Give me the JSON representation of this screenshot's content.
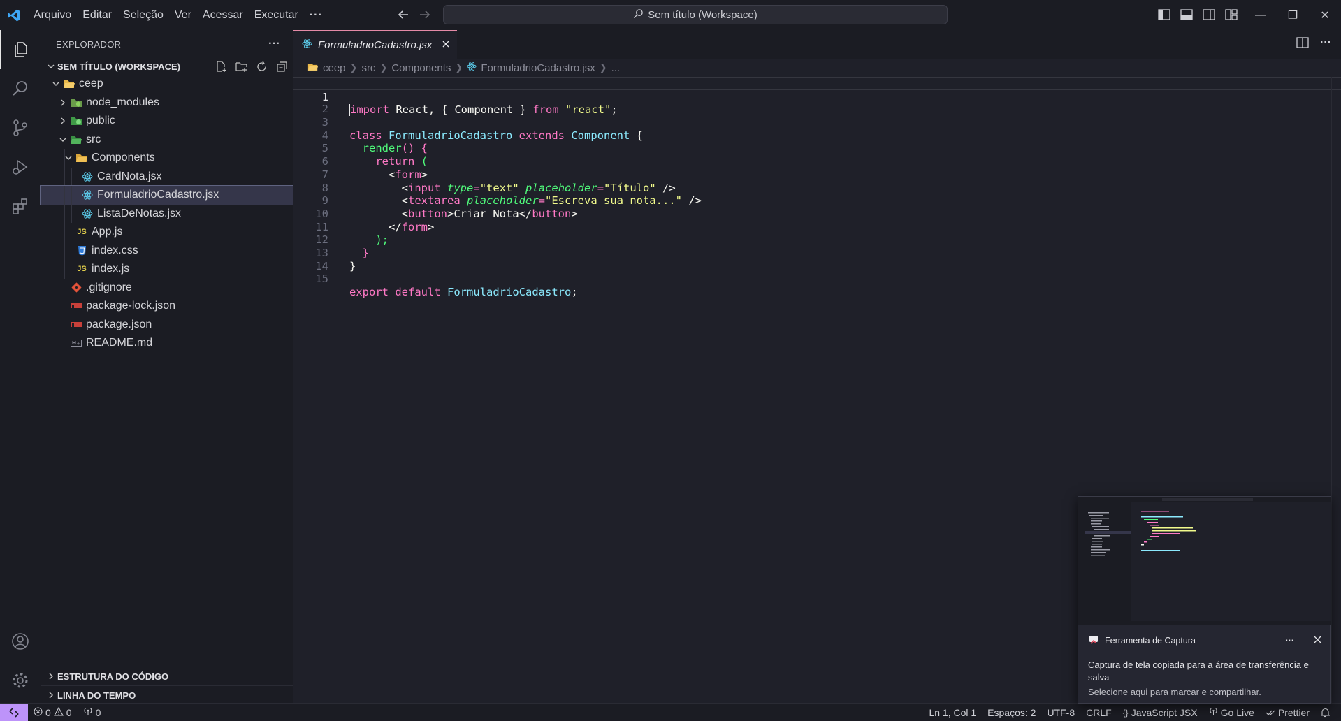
{
  "menu": [
    "Arquivo",
    "Editar",
    "Seleção",
    "Ver",
    "Acessar",
    "Executar"
  ],
  "menu_more": "···",
  "command_center": "Sem título (Workspace)",
  "window_controls": {
    "minimize": "—",
    "restore": "❐",
    "close": "✕"
  },
  "sidebar": {
    "title": "EXPLORADOR",
    "more": "···",
    "workspace": "SEM TÍTULO (WORKSPACE)",
    "tree": [
      {
        "label": "ceep",
        "type": "folder-open",
        "depth": 0
      },
      {
        "label": "node_modules",
        "type": "folder-closed",
        "depth": 1
      },
      {
        "label": "public",
        "type": "folder-closed",
        "depth": 1
      },
      {
        "label": "src",
        "type": "folder-open",
        "depth": 1
      },
      {
        "label": "Components",
        "type": "folder-open",
        "depth": 2
      },
      {
        "label": "CardNota.jsx",
        "type": "react",
        "depth": 3
      },
      {
        "label": "FormuladrioCadastro.jsx",
        "type": "react",
        "depth": 3,
        "selected": true
      },
      {
        "label": "ListaDeNotas.jsx",
        "type": "react",
        "depth": 3
      },
      {
        "label": "App.js",
        "type": "js",
        "depth": 2
      },
      {
        "label": "index.css",
        "type": "css",
        "depth": 2
      },
      {
        "label": "index.js",
        "type": "js",
        "depth": 2
      },
      {
        "label": ".gitignore",
        "type": "git",
        "depth": 1
      },
      {
        "label": "package-lock.json",
        "type": "json",
        "depth": 1
      },
      {
        "label": "package.json",
        "type": "json",
        "depth": 1
      },
      {
        "label": "README.md",
        "type": "md",
        "depth": 1
      }
    ],
    "panels": [
      "ESTRUTURA DO CÓDIGO",
      "LINHA DO TEMPO"
    ]
  },
  "tab": {
    "label": "FormuladrioCadastro.jsx"
  },
  "breadcrumb": {
    "parts": [
      "ceep",
      "src",
      "Components"
    ],
    "file": "FormuladrioCadastro.jsx",
    "more": "..."
  },
  "code_lines": [
    "import React, { Component } from \"react\";",
    "",
    "class FormuladrioCadastro extends Component {",
    "  render() {",
    "    return (",
    "      <form>",
    "        <input type=\"text\" placeholder=\"Título\" />",
    "        <textarea placeholder=\"Escreva sua nota...\" />",
    "        <button>Criar Nota</button>",
    "      </form>",
    "    );",
    "  }",
    "}",
    "",
    "export default FormuladrioCadastro;"
  ],
  "statusbar": {
    "errors": "0",
    "warnings": "0",
    "ports": "0",
    "position": "Ln 1, Col 1",
    "spaces": "Espaços: 2",
    "encoding": "UTF-8",
    "eol": "CRLF",
    "language": "JavaScript JSX",
    "golive": "Go Live",
    "prettier": "Prettier"
  },
  "notification": {
    "app": "Ferramenta de Captura",
    "more": "···",
    "message": "Captura de tela copiada para a área de transferência e salva",
    "submessage": "Selecione aqui para marcar e compartilhar."
  },
  "colors": {
    "accent": "#bd93f9",
    "tab_border": "#e58aa7",
    "background": "#1f2029",
    "sidebar": "#1b1c23"
  }
}
